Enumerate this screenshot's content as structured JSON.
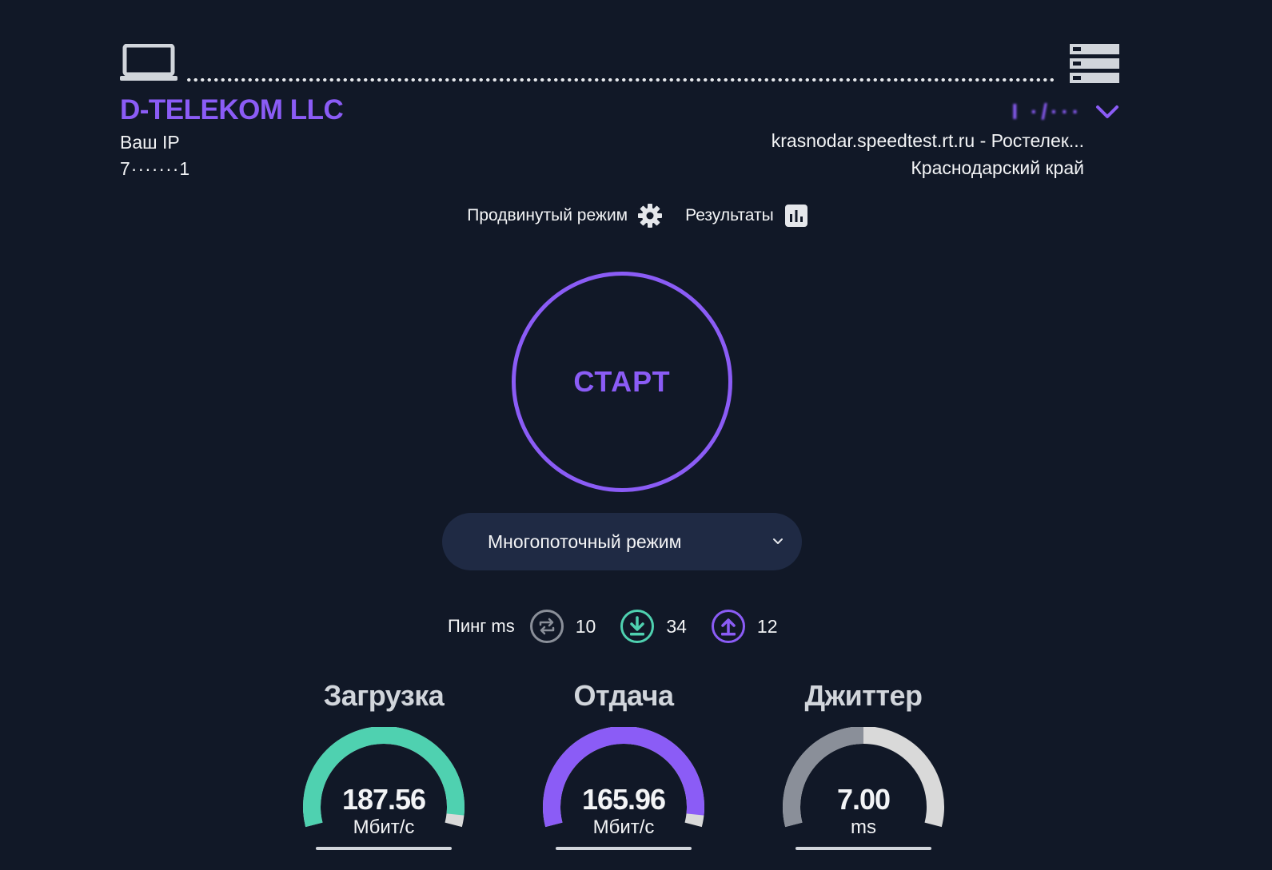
{
  "client": {
    "isp_name": "D-TELEKOM LLC",
    "ip_label": "Ваш IP",
    "ip_value": "7·······1"
  },
  "server": {
    "selected_name": "I ·/···",
    "host": "krasnodar.speedtest.rt.ru - Ростелек...",
    "region": "Краснодарский край"
  },
  "links": {
    "advanced_mode": "Продвинутый режим",
    "results": "Результаты"
  },
  "start_button": {
    "label": "СТАРТ"
  },
  "mode_select": {
    "value": "Многопоточный режим"
  },
  "ping": {
    "label": "Пинг ms",
    "idle": "10",
    "download": "34",
    "upload": "12"
  },
  "gauges": [
    {
      "title": "Загрузка",
      "value": "187.56",
      "unit": "Мбит/с",
      "color": "#4fd1b0",
      "level": 0.96
    },
    {
      "title": "Отдача",
      "value": "165.96",
      "unit": "Мбит/с",
      "color": "#8b5cf6",
      "level": 0.96
    },
    {
      "title": "Джиттер",
      "value": "7.00",
      "unit": "ms",
      "color": "#8a8f99",
      "level": 0.5
    }
  ],
  "colors": {
    "background": "#111827",
    "accent": "#8b5cf6",
    "download": "#4fd1b0",
    "gauge_track": "#d9d9d9"
  }
}
